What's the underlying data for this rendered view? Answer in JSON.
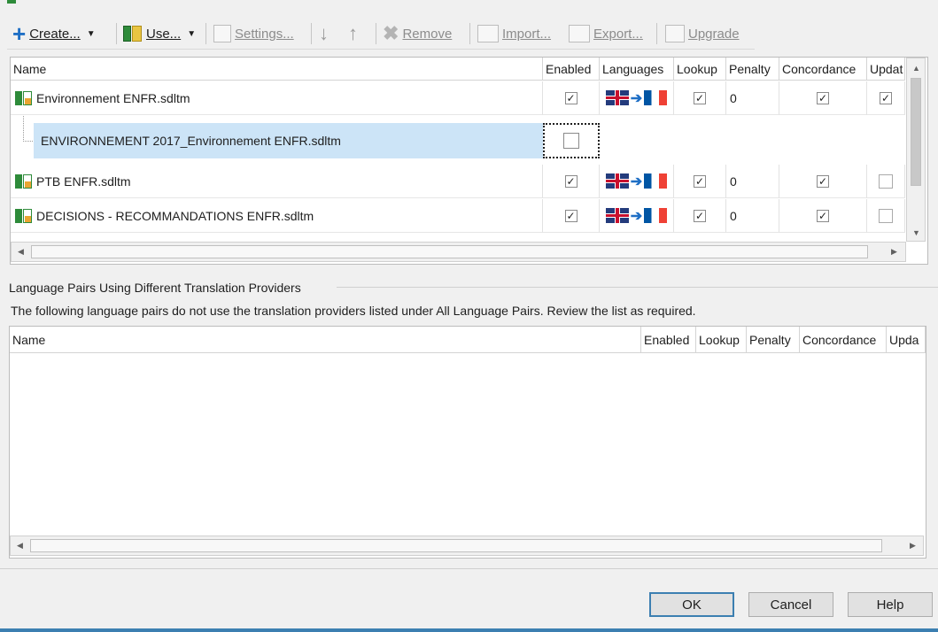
{
  "toolbar": {
    "create_label": "Create...",
    "use_label": "Use...",
    "settings_label": "Settings...",
    "remove_label": "Remove",
    "import_label": "Import...",
    "export_label": "Export...",
    "upgrade_label": "Upgrade"
  },
  "providers_grid": {
    "columns": [
      "Name",
      "Enabled",
      "Languages",
      "Lookup",
      "Penalty",
      "Concordance",
      "Updat"
    ],
    "rows": [
      {
        "name": "Environnement ENFR.sdltm",
        "enabled": true,
        "lookup": true,
        "penalty": "0",
        "concordance": true,
        "update": true
      },
      {
        "name": "ENVIRONNEMENT 2017_Environnement ENFR.sdltm",
        "enabled": false,
        "selected": true
      },
      {
        "name": "PTB ENFR.sdltm",
        "enabled": true,
        "lookup": true,
        "penalty": "0",
        "concordance": true,
        "update": false
      },
      {
        "name": "DECISIONS - RECOMMANDATIONS ENFR.sdltm",
        "enabled": true,
        "lookup": true,
        "penalty": "0",
        "concordance": true,
        "update": false
      }
    ]
  },
  "section": {
    "title": "Language Pairs Using Different Translation Providers",
    "description": "The following language pairs do not use the translation providers listed under All Language Pairs. Review the list as required."
  },
  "pairs_grid": {
    "columns": [
      "Name",
      "Enabled",
      "Lookup",
      "Penalty",
      "Concordance",
      "Upda"
    ]
  },
  "buttons": {
    "ok": "OK",
    "cancel": "Cancel",
    "help": "Help"
  },
  "colors": {
    "selection": "#cce4f7",
    "accent_blue": "#1f6fc5",
    "tm_green": "#2e8b3a"
  }
}
